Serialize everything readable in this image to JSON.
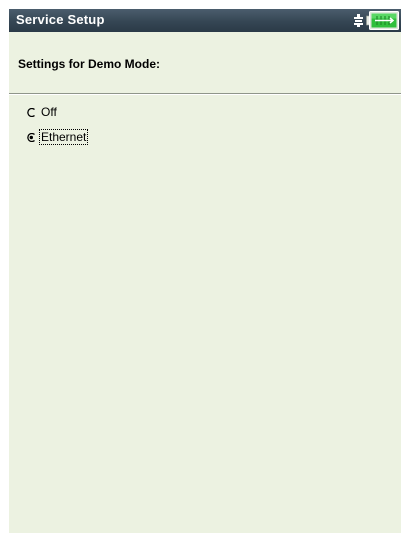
{
  "window": {
    "title": "Service Setup"
  },
  "status": {
    "usb_icon": "usb-plug-icon",
    "battery_icon": "battery-charging-icon",
    "battery_color": "#2fbf3c"
  },
  "section": {
    "title": "Settings for Demo Mode:"
  },
  "demo_mode": {
    "selected": "Ethernet",
    "options": [
      {
        "label": "Off",
        "checked": false
      },
      {
        "label": "Ethernet",
        "checked": true
      }
    ]
  },
  "colors": {
    "background": "#ecf2e1",
    "titlebar": "#354654"
  }
}
